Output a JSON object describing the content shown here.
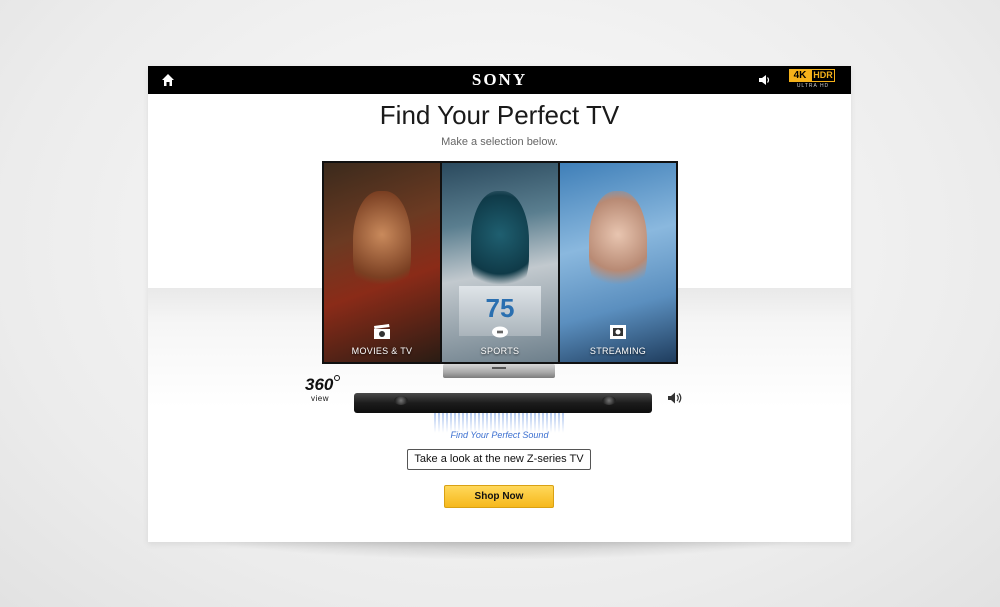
{
  "header": {
    "brand": "SONY",
    "badge": {
      "top_left": "4K",
      "top_right": "HDR",
      "bottom": "ULTRA HD"
    },
    "home_icon": "home-icon",
    "speaker_icon": "speaker-icon"
  },
  "main": {
    "title": "Find Your Perfect TV",
    "subtitle": "Make a selection below.",
    "categories": [
      {
        "label": "MOVIES & TV",
        "icon": "clapperboard-icon"
      },
      {
        "label": "SPORTS",
        "icon": "football-icon"
      },
      {
        "label": "STREAMING",
        "icon": "film-strip-icon"
      }
    ],
    "jersey_number": "75",
    "view360": {
      "number": "360",
      "label": "view"
    },
    "sound_link": "Find Your Perfect Sound",
    "zseries_label": "Take a look at the new Z-series TV",
    "shop_label": "Shop Now"
  },
  "colors": {
    "topbar": "#000000",
    "accent_gold": "#f6b81c",
    "link_blue": "#3b6fd0",
    "panel": "#ffffff"
  }
}
